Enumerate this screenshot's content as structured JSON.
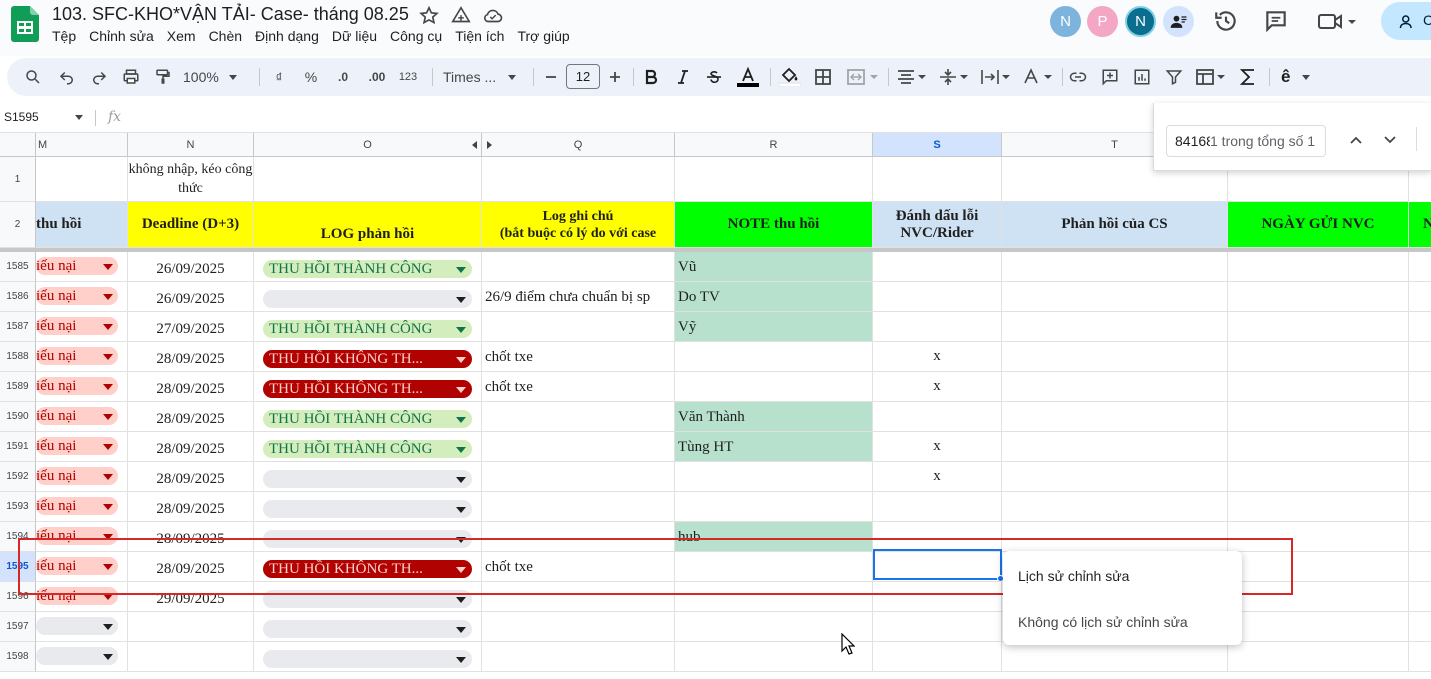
{
  "app": {
    "title": "103. SFC-KHO*VẬN TẢI- Case- tháng 08.25",
    "menu": [
      "Tệp",
      "Chỉnh sửa",
      "Xem",
      "Chèn",
      "Định dạng",
      "Dữ liệu",
      "Công cụ",
      "Tiện ích",
      "Trợ giúp"
    ],
    "avatars": [
      {
        "letter": "N",
        "color": "#7cb4dd"
      },
      {
        "letter": "P",
        "color": "#f4a7c5"
      },
      {
        "letter": "N",
        "color": "#0b6e8e"
      }
    ],
    "share_label": "C"
  },
  "toolbar": {
    "zoom": "100%",
    "currency": "₫",
    "percent": "%",
    "dec_less": ".0",
    "dec_more": ".00",
    "number_format": "123",
    "font": "Times ...",
    "font_size": "12",
    "text_format": "ê"
  },
  "formula_bar": {
    "name_box": "S1595",
    "fx": "fx"
  },
  "find": {
    "query": "84168",
    "count": "1 trong tổng số 1"
  },
  "columns": [
    {
      "letter": "M"
    },
    {
      "letter": "N"
    },
    {
      "letter": "O"
    },
    {
      "letter": "Q"
    },
    {
      "letter": "R"
    },
    {
      "letter": "S"
    },
    {
      "letter": "T"
    },
    {
      "letter": ""
    },
    {
      "letter": ""
    }
  ],
  "row1": {
    "N": "không nhập, kéo công thức"
  },
  "headers": {
    "M": "thu hồi",
    "N": "Deadline (D+3)",
    "O": "LOG phản hồi",
    "Q": "Log ghi chú\n(bắt buộc có lý do với case",
    "R": "NOTE thu hồi",
    "S": "Đánh dấu lỗi NVC/Rider",
    "T": "Phản hồi của CS",
    "U": "NGÀY GỬI NVC",
    "V": "N"
  },
  "rows": [
    {
      "num": "1585",
      "m": "iếu nại",
      "n": "26/09/2025",
      "o": "THU HỒI THÀNH CÔNG",
      "o_type": "success",
      "q": "",
      "r": "Vũ",
      "r_green": true,
      "s": ""
    },
    {
      "num": "1586",
      "m": "iếu nại",
      "n": "26/09/2025",
      "o": "",
      "o_type": "empty",
      "q": "26/9 điểm chưa chuẩn bị sp",
      "r": "Do TV",
      "r_green": true,
      "s": ""
    },
    {
      "num": "1587",
      "m": "iếu nại",
      "n": "27/09/2025",
      "o": "THU HỒI THÀNH CÔNG",
      "o_type": "success",
      "q": "",
      "r": "Vỹ",
      "r_green": true,
      "s": ""
    },
    {
      "num": "1588",
      "m": "iếu nại",
      "n": "28/09/2025",
      "o": "THU HỒI KHÔNG TH...",
      "o_type": "fail",
      "q": "chốt txe",
      "r": "",
      "r_green": false,
      "s": "x"
    },
    {
      "num": "1589",
      "m": "iếu nại",
      "n": "28/09/2025",
      "o": "THU HỒI KHÔNG TH...",
      "o_type": "fail",
      "q": "chốt txe",
      "r": "",
      "r_green": false,
      "s": "x"
    },
    {
      "num": "1590",
      "m": "iếu nại",
      "n": "28/09/2025",
      "o": "THU HỒI THÀNH CÔNG",
      "o_type": "success",
      "q": "",
      "r": "Văn Thành",
      "r_green": true,
      "s": ""
    },
    {
      "num": "1591",
      "m": "iếu nại",
      "n": "28/09/2025",
      "o": "THU HỒI THÀNH CÔNG",
      "o_type": "success",
      "q": "",
      "r": "Tùng HT",
      "r_green": true,
      "s": "x"
    },
    {
      "num": "1592",
      "m": "iếu nại",
      "n": "28/09/2025",
      "o": "",
      "o_type": "empty",
      "q": "",
      "r": "",
      "r_green": false,
      "s": "x"
    },
    {
      "num": "1593",
      "m": "iếu nại",
      "n": "28/09/2025",
      "o": "",
      "o_type": "empty",
      "q": "",
      "r": "",
      "r_green": false,
      "s": ""
    },
    {
      "num": "1594",
      "m": "iếu nại",
      "n": "28/09/2025",
      "o": "",
      "o_type": "empty",
      "q": "",
      "r": "hub",
      "r_green": true,
      "s": ""
    },
    {
      "num": "1595",
      "m": "iếu nại",
      "n": "28/09/2025",
      "o": "THU HỒI KHÔNG TH...",
      "o_type": "fail",
      "q": "chốt txe",
      "r": "",
      "r_green": false,
      "s": ""
    },
    {
      "num": "1596",
      "m": "iếu nại",
      "n": "29/09/2025",
      "o": "",
      "o_type": "empty",
      "q": "",
      "r": "",
      "r_green": false,
      "s": ""
    },
    {
      "num": "1597",
      "m": "",
      "n": "",
      "o": "",
      "o_type": "empty",
      "q": "",
      "r": "",
      "r_green": false,
      "s": ""
    },
    {
      "num": "1598",
      "m": "",
      "n": "",
      "o": "",
      "o_type": "empty",
      "q": "",
      "r": "",
      "r_green": false,
      "s": ""
    }
  ],
  "context_popup": {
    "title": "Lịch sử chỉnh sửa",
    "subtitle": "Không có lịch sử chỉnh sửa"
  },
  "colors": {
    "header_yellow": "#ffff00",
    "header_green": "#00ff00",
    "header_blue": "#cfe2f3",
    "note_green": "#b7e1cd",
    "chip_success_bg": "#d4edbc",
    "chip_success_fg": "#11734b",
    "chip_fail_bg": "#b10202",
    "chip_fail_fg": "#ffcfc9",
    "chip_m_bg": "#ffcfc9",
    "chip_m_fg": "#b10202"
  }
}
